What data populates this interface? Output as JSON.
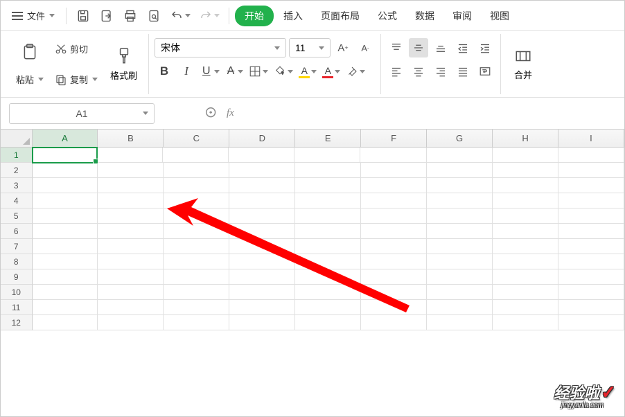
{
  "menu": {
    "file_label": "文件",
    "tabs": {
      "start": "开始",
      "insert": "插入",
      "page_layout": "页面布局",
      "formula": "公式",
      "data": "数据",
      "review": "审阅",
      "view": "视图"
    }
  },
  "ribbon": {
    "clipboard": {
      "paste_label": "粘贴",
      "cut_label": "剪切",
      "copy_label": "复制",
      "format_painter_label": "格式刷"
    },
    "font": {
      "name": "宋体",
      "size": "11"
    },
    "merge_label": "合并"
  },
  "namebox": {
    "value": "A1"
  },
  "fx": {
    "label": "fx"
  },
  "columns": [
    "A",
    "B",
    "C",
    "D",
    "E",
    "F",
    "G",
    "H",
    "I"
  ],
  "rows": [
    "1",
    "2",
    "3",
    "4",
    "5",
    "6",
    "7",
    "8",
    "9",
    "10",
    "11",
    "12"
  ],
  "watermark": {
    "main": "经验啦",
    "sub": "jingyanla.com"
  }
}
